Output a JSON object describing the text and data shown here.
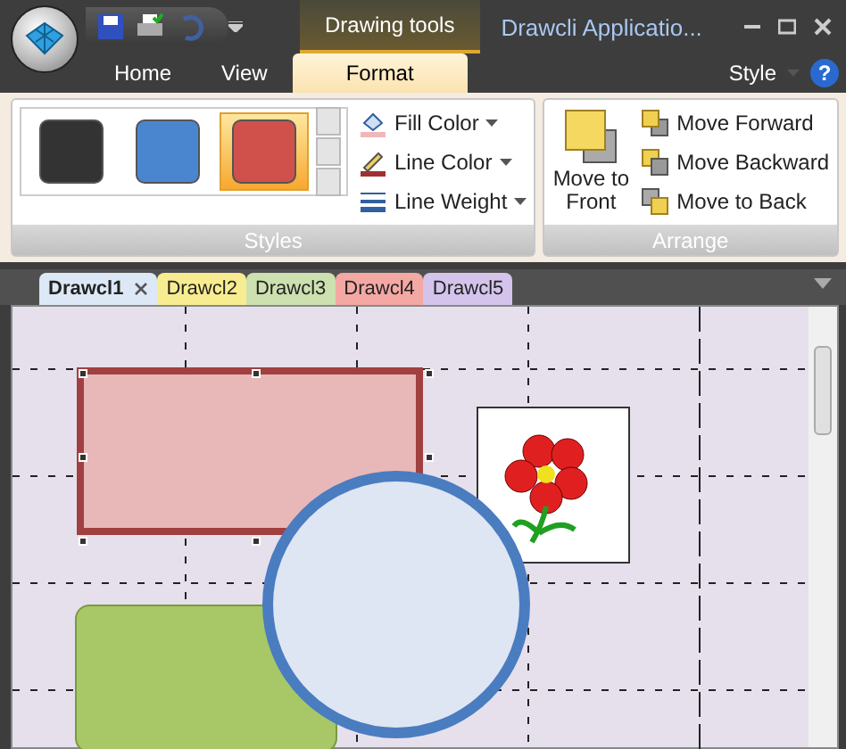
{
  "window": {
    "title": "Drawcli Applicatio...",
    "context_tab": "Drawing tools"
  },
  "ribbon_tabs": [
    {
      "label": "Home",
      "selected": false
    },
    {
      "label": "View",
      "selected": false
    },
    {
      "label": "Format",
      "selected": true
    }
  ],
  "style_menu": {
    "label": "Style"
  },
  "help_button": {
    "label": "?"
  },
  "groups": [
    {
      "title": "Styles",
      "kind": "styles",
      "swatches": [
        {
          "color": "#333333",
          "selected": false
        },
        {
          "color": "#4a86d0",
          "selected": false
        },
        {
          "color": "#d0504c",
          "selected": true
        }
      ],
      "commands": [
        {
          "label": "Fill Color"
        },
        {
          "label": "Line Color"
        },
        {
          "label": "Line Weight"
        }
      ]
    },
    {
      "title": "Arrange",
      "kind": "arrange",
      "big_command": {
        "label": "Move to Front"
      },
      "commands": [
        {
          "label": "Move Forward"
        },
        {
          "label": "Move Backward"
        },
        {
          "label": "Move to Back"
        }
      ]
    }
  ],
  "documents": [
    {
      "label": "Drawcl1",
      "selected": true,
      "color": "#dce8f6"
    },
    {
      "label": "Drawcl2",
      "selected": false,
      "color": "#f8ec90"
    },
    {
      "label": "Drawcl3",
      "selected": false,
      "color": "#cce0b0"
    },
    {
      "label": "Drawcl4",
      "selected": false,
      "color": "#f4a8a4"
    },
    {
      "label": "Drawcl5",
      "selected": false,
      "color": "#d4c4ec"
    }
  ],
  "shapes": [
    {
      "kind": "rectangle",
      "color": "#e8b8b8",
      "selected": true
    },
    {
      "kind": "picture",
      "selected": false
    },
    {
      "kind": "rounded_rectangle",
      "color": "#a8c868",
      "selected": false
    },
    {
      "kind": "ellipse",
      "color": "#dde6f2",
      "selected": false
    }
  ]
}
